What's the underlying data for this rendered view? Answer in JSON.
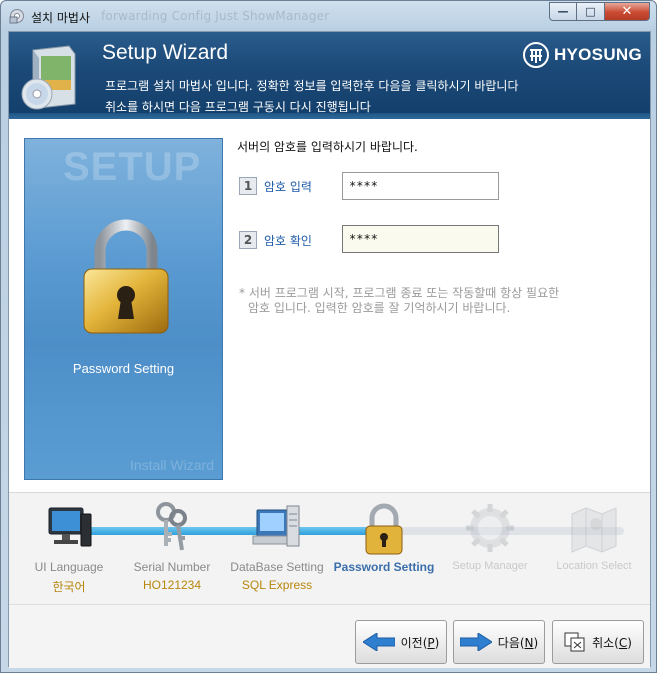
{
  "window": {
    "title": "설치 마법사",
    "background_title": "forwarding Config  Just ShowManager"
  },
  "header": {
    "title": "Setup Wizard",
    "line1": "프로그램 설치 마법사 입니다. 정확한 정보를 입력한후 다음을 클릭하시기 바랍니다",
    "line2": "취소를 하시면 다음 프로그램 구동시 다시 진행됩니다",
    "logo_text": "HYOSUNG"
  },
  "panel": {
    "watermark": "SETUP",
    "label": "Password Setting",
    "footer_watermark": "Install Wizard",
    "icon": "padlock-icon"
  },
  "form": {
    "prompt": "서버의 암호를 입력하시기 바랍니다.",
    "fields": [
      {
        "num": "1",
        "label": "암호 입력",
        "value": "****"
      },
      {
        "num": "2",
        "label": "암호 확인",
        "value": "****"
      }
    ],
    "note_line1": "* 서버 프로그램 시작, 프로그램 종료 또는 작동할때 항상 필요한",
    "note_line2": "암호 입니다. 입력한 암호를 잘 기억하시기 바랍니다."
  },
  "steps": [
    {
      "name": "UI Language",
      "value": "한국어",
      "icon": "monitor-icon",
      "state": "done"
    },
    {
      "name": "Serial Number",
      "value": "HO121234",
      "icon": "keys-icon",
      "state": "done"
    },
    {
      "name": "DataBase Setting",
      "value": "SQL Express",
      "icon": "server-icon",
      "state": "done"
    },
    {
      "name": "Password Setting",
      "value": "",
      "icon": "padlock-icon",
      "state": "current"
    },
    {
      "name": "Setup Manager",
      "value": "",
      "icon": "gear-globe-icon",
      "state": "future"
    },
    {
      "name": "Location Select",
      "value": "",
      "icon": "map-icon",
      "state": "future"
    }
  ],
  "buttons": {
    "prev": {
      "label": "이전(",
      "hotkey": "P",
      "close": ")"
    },
    "next": {
      "label": "다음(",
      "hotkey": "N",
      "close": ")"
    },
    "cancel": {
      "label": "취소(",
      "hotkey": "C",
      "close": ")"
    }
  },
  "colors": {
    "header_bg": "#1c4a78",
    "panel_bg": "#5b9bd2",
    "progress": "#2ea1dc",
    "step_value": "#b7860b",
    "field_label": "#1f5aa6"
  }
}
